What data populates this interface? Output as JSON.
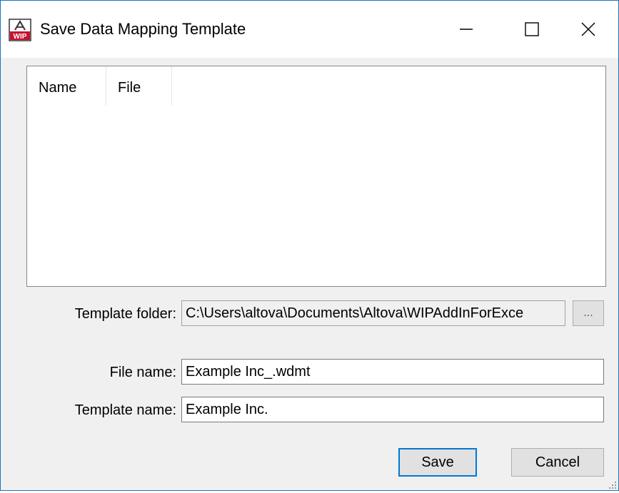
{
  "window": {
    "title": "Save Data Mapping Template",
    "app_icon": "altova-wip-icon",
    "controls": [
      "minimize-icon",
      "maximize-icon",
      "close-icon"
    ]
  },
  "templates_list": {
    "columns": [
      "Name",
      "File"
    ],
    "rows": []
  },
  "form": {
    "template_folder_label": "Template folder:",
    "template_folder_value": "C:\\Users\\altova\\Documents\\Altova\\WIPAddInForExce",
    "browse_label": "...",
    "file_name_label": "File name:",
    "file_name_value": "Example Inc_.wdmt",
    "template_name_label": "Template name:",
    "template_name_value": "Example Inc."
  },
  "buttons": {
    "save_label": "Save",
    "cancel_label": "Cancel"
  },
  "colors": {
    "accent": "#0078d7",
    "icon_red": "#c8102e"
  }
}
